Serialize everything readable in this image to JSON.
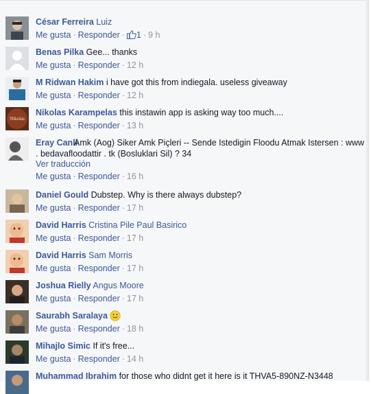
{
  "actions": {
    "like": "Me gusta",
    "reply": "Responder",
    "sep": "·"
  },
  "comments": [
    {
      "author": "César Ferreira",
      "tag": "Luiz",
      "text": "",
      "likes": "1",
      "time": "9 h"
    },
    {
      "author": "Benas Pilka",
      "tag": "",
      "text": "Gee... thanks",
      "time": "12 h"
    },
    {
      "author": "M Ridwan Hakim",
      "tag": "",
      "text": "i have got this from indiegala. useless giveaway",
      "time": "12 h"
    },
    {
      "author": "Nikolas Karampelas",
      "tag": "",
      "text": "this instawin app is asking way too much....",
      "time": "13 h",
      "avatar_label": "Nikolas"
    },
    {
      "author": "Eray Canli",
      "tag": "",
      "text": "Amk (Aog) Siker Amk Piçleri -- Sende Istedigin Floodu Atmak Istersen : www . bedavafloodattir . tk (Bosluklari Sil) ? 34",
      "see_translation": "Ver traducción",
      "time": "16 h"
    },
    {
      "author": "Daniel Gould",
      "tag": "",
      "text": "Dubstep. Why is there always dubstep?",
      "time": "17 h"
    },
    {
      "author": "David Harris",
      "tag": "Cristina Pile Paul Basirico",
      "text": "",
      "time": "17 h"
    },
    {
      "author": "David Harris",
      "tag": "Sam Morris",
      "text": "",
      "time": "17 h"
    },
    {
      "author": "Joshua Rielly",
      "tag": "Angus Moore",
      "text": "",
      "time": "17 h"
    },
    {
      "author": "Saurabh Saralaya",
      "tag": "",
      "text": "",
      "time": "18 h",
      "emoji": "smile-emoji"
    },
    {
      "author": "Mihajlo Simic",
      "tag": "",
      "text": "If it's free...",
      "time": "14 h"
    },
    {
      "author": "Muhammad Ibrahim",
      "tag": "",
      "text": "for those who didnt get it here is it THVA5-890NZ-N3448",
      "time": ""
    }
  ],
  "colors": {
    "link": "#3b5998",
    "meta": "#90949c",
    "panel": "#f6f7f9"
  }
}
